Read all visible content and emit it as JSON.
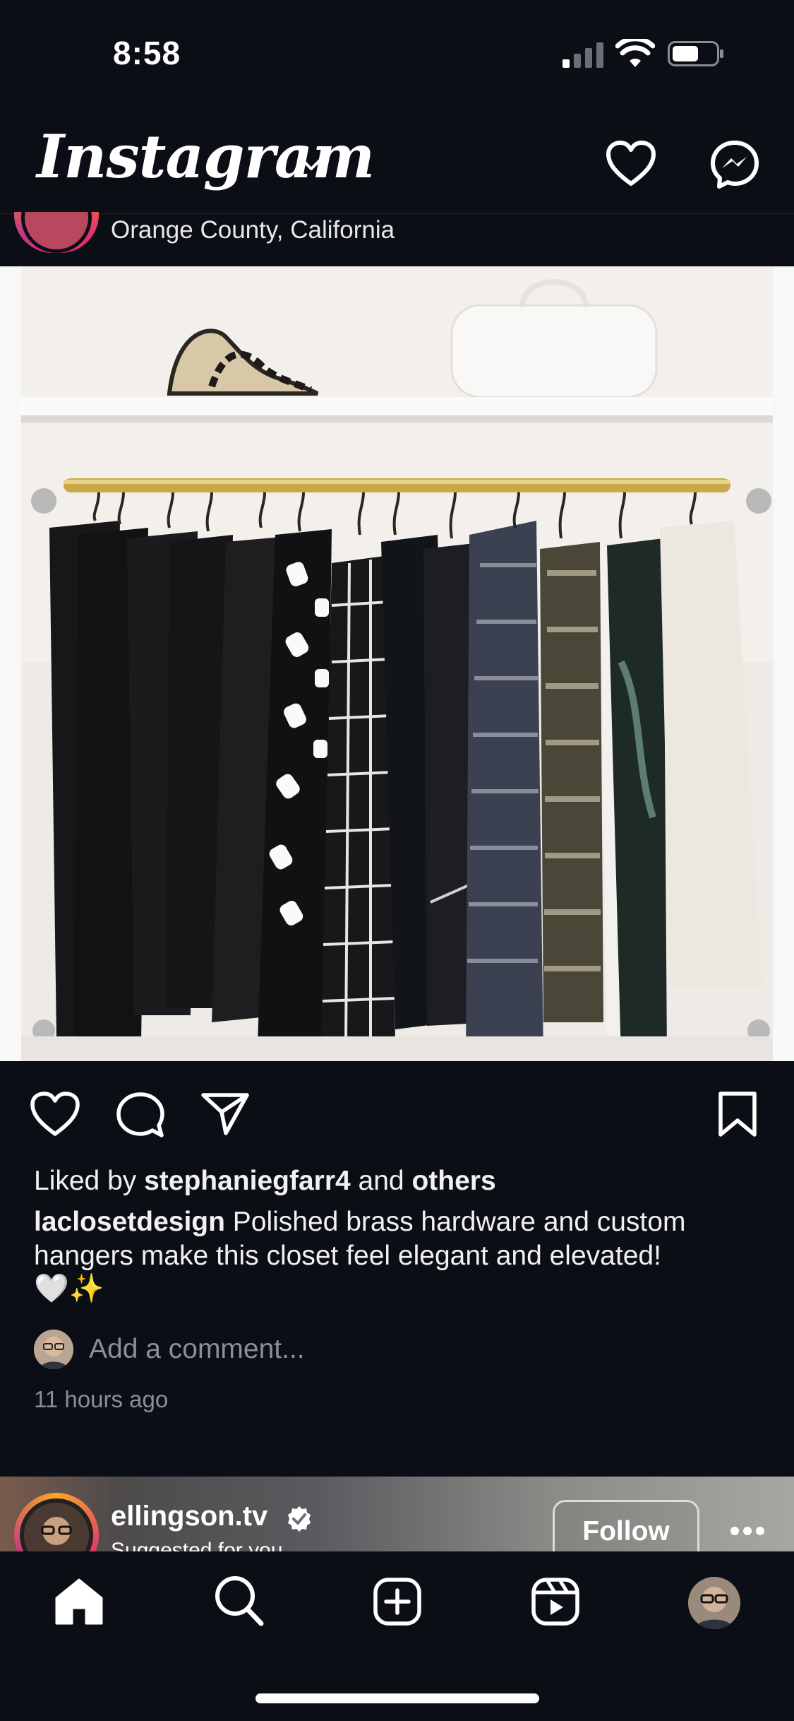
{
  "status_bar": {
    "time": "8:58"
  },
  "header": {
    "logo": "Instagram"
  },
  "post": {
    "location": "Orange County, California",
    "liked_by_prefix": "Liked by ",
    "liked_by_user": "stephaniegfarr4",
    "liked_by_and": " and ",
    "liked_by_others": "others",
    "caption_user": "laclosetdesign",
    "caption_text": " Polished brass hardware and custom hangers make this closet feel elegant and elevated!",
    "caption_emojis": "🤍✨",
    "comment_placeholder": "Add a comment...",
    "time_ago": "11 hours ago"
  },
  "next_post": {
    "username": "ellingson.tv",
    "subtitle": "Suggested for you",
    "follow_label": "Follow"
  },
  "icons": {
    "header": [
      "chevron-down-icon",
      "heart-icon",
      "messenger-icon"
    ],
    "actions": [
      "heart-icon",
      "comment-icon",
      "share-icon",
      "bookmark-icon"
    ],
    "tabs": [
      "home-icon",
      "search-icon",
      "add-icon",
      "reels-icon",
      "profile-avatar"
    ]
  },
  "colors": {
    "background": "#0b0e14",
    "muted_text": "#8c8f96",
    "story_ring": "#e1306c"
  }
}
